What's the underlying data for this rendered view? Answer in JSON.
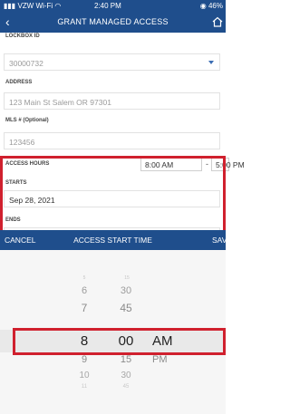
{
  "status_bar": {
    "carrier": "VZW Wi-Fi",
    "time": "2:40 PM",
    "battery": "46%"
  },
  "nav": {
    "title": "GRANT MANAGED ACCESS",
    "back_icon": "chevron-left-icon",
    "home_icon": "home-icon"
  },
  "form": {
    "lockbox_label": "LOCKBOX ID",
    "lockbox_value": "30000732",
    "address_label": "ADDRESS",
    "address_value": "123 Main St  Salem OR 97301",
    "mls_label": "MLS # (Optional)",
    "mls_value": "123456",
    "access_hours_label": "ACCESS HOURS",
    "start_time": "8:00 AM",
    "time_separator": "-",
    "end_time": "5:00 PM",
    "starts_label": "STARTS",
    "starts_value": "Sep 28, 2021",
    "ends_label": "ENDS",
    "ends_value": "Sep 28, 2021"
  },
  "picker_bar": {
    "cancel": "CANCEL",
    "title": "ACCESS START TIME",
    "save": "SAVE"
  },
  "picker": {
    "hours": [
      "5",
      "6",
      "7",
      "8",
      "9",
      "10",
      "11"
    ],
    "minutes": [
      "15",
      "30",
      "45",
      "00",
      "15",
      "30",
      "45"
    ],
    "periods": [
      "AM",
      "PM"
    ],
    "selected_hour": "8",
    "selected_minute": "00",
    "selected_period": "AM"
  },
  "colors": {
    "header": "#1f4e8c",
    "highlight": "#d0202e",
    "caret": "#3b6db3"
  }
}
